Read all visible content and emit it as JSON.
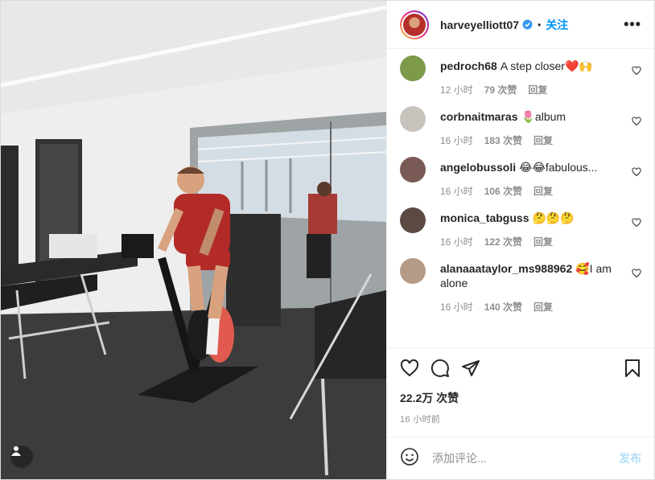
{
  "header": {
    "username": "harveyelliott07",
    "separator": "•",
    "follow_label": "关注",
    "more_label": "•••"
  },
  "comments": [
    {
      "user": "pedroch68",
      "text": "A step closer❤️🙌",
      "time": "12 小时",
      "likes": "79 次赞",
      "reply": "回复",
      "avatar_color": "#7c9a4a"
    },
    {
      "user": "corbnaitmaras",
      "text": "🌷album",
      "time": "16 小时",
      "likes": "183 次赞",
      "reply": "回复",
      "avatar_color": "#c8c3bd"
    },
    {
      "user": "angelobussoli",
      "text": "😂😂fabulous...",
      "time": "16 小时",
      "likes": "106 次赞",
      "reply": "回复",
      "avatar_color": "#7a5a55"
    },
    {
      "user": "monica_tabguss",
      "text": "🤔🤔🤔",
      "time": "16 小时",
      "likes": "122 次赞",
      "reply": "回复",
      "avatar_color": "#5b4a44"
    },
    {
      "user": "alanaaataylor_ms988962",
      "text": "🥰I am alone",
      "time": "16 小时",
      "likes": "140 次赞",
      "reply": "回复",
      "avatar_color": "#b59a86"
    }
  ],
  "post": {
    "likes": "22.2万 次赞",
    "time": "16 小时前"
  },
  "add_comment": {
    "placeholder": "添加评论...",
    "post_label": "发布"
  },
  "colors": {
    "accent": "#0095f6",
    "post_disabled": "#b2dffc",
    "like_red": "#ed4956"
  }
}
